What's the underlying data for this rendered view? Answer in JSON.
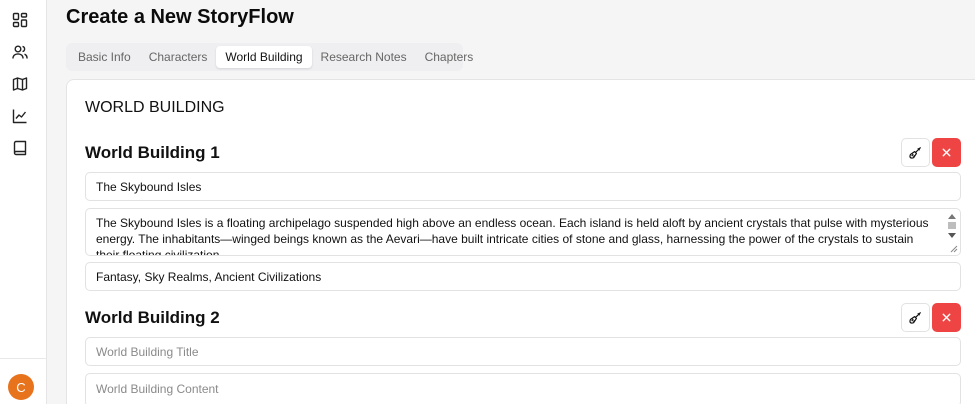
{
  "sidebar": {
    "items": [
      {
        "icon": "dashboard-icon"
      },
      {
        "icon": "users-icon"
      },
      {
        "icon": "map-icon"
      },
      {
        "icon": "chart-line-icon"
      },
      {
        "icon": "book-icon"
      }
    ],
    "avatar_initial": "C",
    "avatar_color": "#e8731d"
  },
  "page": {
    "title": "Create a New StoryFlow"
  },
  "tabs": [
    {
      "label": "Basic Info",
      "active": false
    },
    {
      "label": "Characters",
      "active": false
    },
    {
      "label": "World Building",
      "active": true
    },
    {
      "label": "Research Notes",
      "active": false
    },
    {
      "label": "Chapters",
      "active": false
    }
  ],
  "main": {
    "section_title": "WORLD BUILDING",
    "entries": [
      {
        "heading": "World Building 1",
        "title_value": "The Skybound Isles",
        "content_value": "The Skybound Isles is a floating archipelago suspended high above an endless ocean. Each island is held aloft by ancient crystals that pulse with mysterious energy. The inhabitants—winged beings known as the Aevari—have built intricate cities of stone and glass, harnessing the power of the crystals to sustain their floating civilization.",
        "tags_value": "Fantasy, Sky Realms, Ancient Civilizations"
      },
      {
        "heading": "World Building 2",
        "title_placeholder": "World Building Title",
        "content_placeholder": "World Building Content"
      }
    ]
  },
  "colors": {
    "danger": "#ef4444",
    "accent": "#e8731d"
  }
}
